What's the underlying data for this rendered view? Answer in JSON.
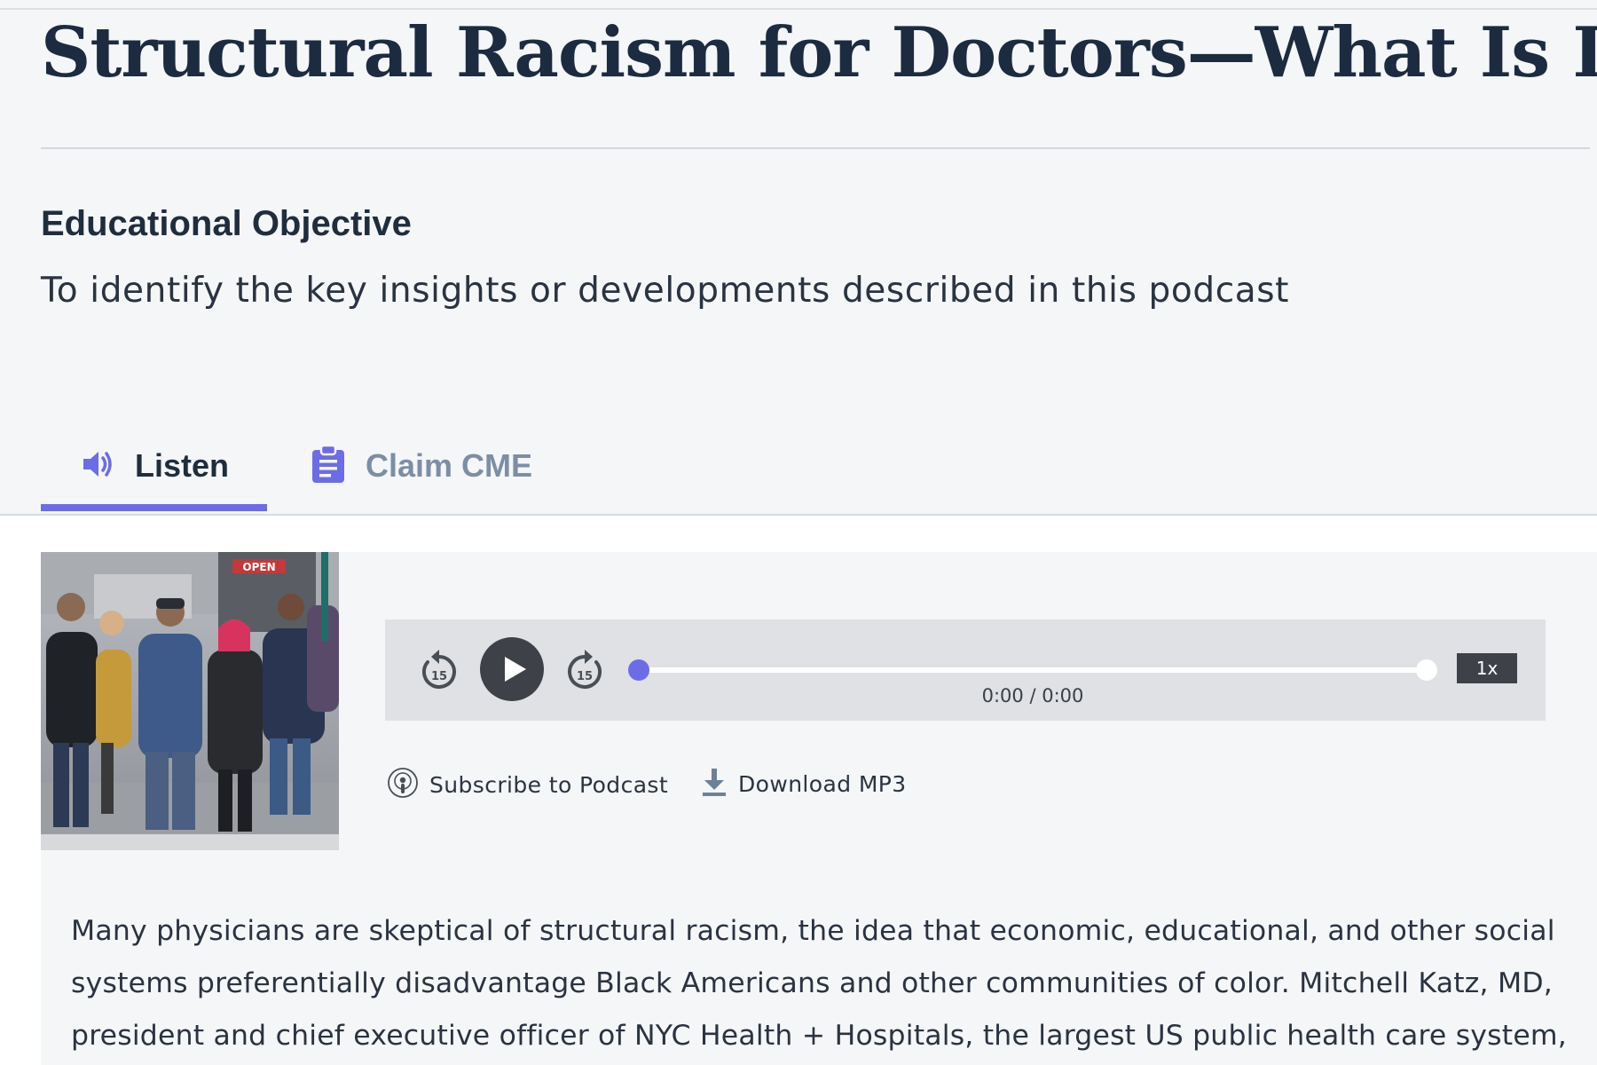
{
  "article": {
    "title": "Structural Racism for Doctors—What Is It?"
  },
  "objective": {
    "heading": "Educational Objective",
    "text": "To identify the key insights or developments described in this podcast"
  },
  "tabs": [
    {
      "label": "Listen",
      "icon": "speaker-icon",
      "active": true
    },
    {
      "label": "Claim CME",
      "icon": "clipboard-icon",
      "active": false
    }
  ],
  "colors": {
    "accent": "#6b6ce6",
    "inactive_tab": "#7d8ea4",
    "player_bg": "#dfe1e4"
  },
  "player": {
    "time": "0:00 / 0:00",
    "speed": "1x",
    "rewind_seconds": "15",
    "forward_seconds": "15",
    "progress": 0
  },
  "links": {
    "subscribe": "Subscribe to Podcast",
    "download": "Download MP3"
  },
  "thumbnail": {
    "sign_text": "OPEN"
  },
  "description": "Many physicians are skeptical of structural racism, the idea that economic, educational, and other social systems preferentially disadvantage Black Americans and other communities of color. Mitchell Katz, MD, president and chief executive officer of NYC Health + Hospitals, the largest US public health care system,"
}
